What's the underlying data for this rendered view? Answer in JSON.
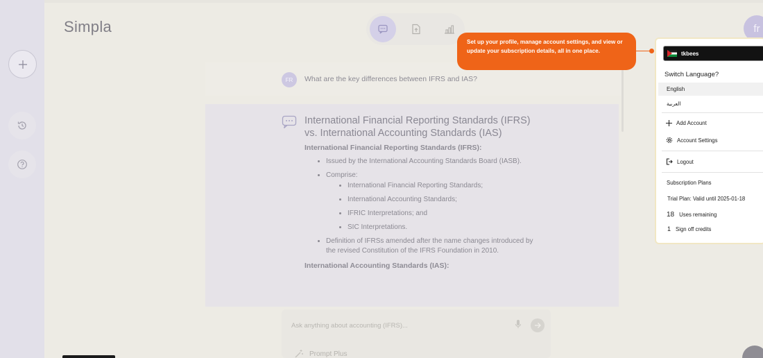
{
  "app": {
    "logo": "Simpla"
  },
  "sidebar": {
    "new_chat_icon": "plus-icon",
    "history_icon": "history-icon",
    "help_icon": "question-icon"
  },
  "modes": [
    {
      "icon": "chat-icon",
      "active": true
    },
    {
      "icon": "upload-file-icon",
      "active": false
    },
    {
      "icon": "chart-icon",
      "active": false
    }
  ],
  "user": {
    "initials": "fr"
  },
  "conversation": {
    "question_avatar": "FR",
    "question": "What are the key differences between IFRS and IAS?",
    "answer": {
      "title": "International Financial Reporting Standards (IFRS) vs. International Accounting Standards (IAS)",
      "section1_heading": "International Financial Reporting Standards (IFRS):",
      "issued_by": "Issued by the International Accounting Standards Board (IASB).",
      "comprise_label": "Comprise:",
      "comprise_items": [
        "International Financial Reporting Standards;",
        "International Accounting Standards;",
        "IFRIC Interpretations; and",
        "SIC Interpretations."
      ],
      "definition": "Definition of IFRSs amended after the name changes introduced by the revised Constitution of the IFRS Foundation in 2010.",
      "section2_heading": "International Accounting Standards (IAS):"
    }
  },
  "composer": {
    "placeholder": "Ask anything about accounting (IFRS)...",
    "prompt_plus": "Prompt Plus"
  },
  "tooltip": {
    "text": "Set up your profile, manage account settings, and view or update your subscription details, all in one place.",
    "color": "#ef6418"
  },
  "profile_menu": {
    "account_name": "tkbees",
    "switch_language_label": "Switch Language?",
    "languages": [
      "English",
      "العربية"
    ],
    "add_account": "Add Account",
    "account_settings": "Account Settings",
    "logout": "Logout",
    "subscription_heading": "Subscription Plans",
    "trial_plan": "Trial Plan: Valid until 2025-01-18",
    "uses_count": "18",
    "uses_label": "Uses remaining",
    "credits_count": "1",
    "credits_label": "Sign off credits"
  }
}
